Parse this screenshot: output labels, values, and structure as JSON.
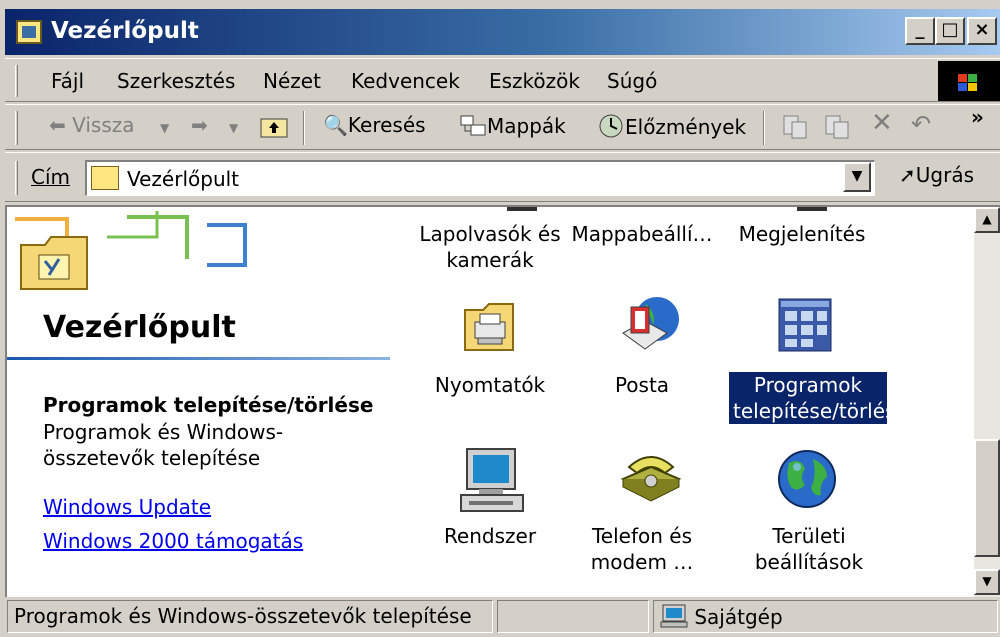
{
  "window": {
    "title": "Vezérlőpult"
  },
  "menu": {
    "items": [
      {
        "label": "Fájl"
      },
      {
        "label": "Szerkesztés"
      },
      {
        "label": "Nézet"
      },
      {
        "label": "Kedvencek"
      },
      {
        "label": "Eszközök"
      },
      {
        "label": "Súgó"
      }
    ]
  },
  "toolbar": {
    "back_label": "Vissza",
    "search_label": "Keresés",
    "folders_label": "Mappák",
    "history_label": "Előzmények",
    "more_glyph": "»"
  },
  "address": {
    "label": "Cím",
    "value": "Vezérlőpult",
    "go_label": "Ugrás"
  },
  "leftpane": {
    "heading": "Vezérlőpult",
    "selected_title": "Programok telepítése/törlése",
    "selected_desc": "Programok és Windows-összetevők telepítése",
    "links": [
      {
        "label": "Windows Update"
      },
      {
        "label": "Windows 2000 támogatás"
      }
    ]
  },
  "items": [
    {
      "label": "Lapolvasók és kamerák",
      "icon": "scanner-camera-icon"
    },
    {
      "label": "Mappabeállí…",
      "icon": "folder-options-icon"
    },
    {
      "label": "Megjelenítés",
      "icon": "display-icon"
    },
    {
      "label": "Nyomtatók",
      "icon": "printer-folder-icon"
    },
    {
      "label": "Posta",
      "icon": "mail-icon"
    },
    {
      "label": "Programok telepítése/törlése",
      "icon": "add-remove-programs-icon",
      "selected": true
    },
    {
      "label": "Rendszer",
      "icon": "computer-icon"
    },
    {
      "label": "Telefon és modem …",
      "icon": "telephone-icon"
    },
    {
      "label": "Területi beállítások",
      "icon": "globe-icon"
    }
  ],
  "status": {
    "text": "Programok és Windows-összetevők telepítése",
    "zone": "Sajátgép"
  },
  "colors": {
    "title_active": "#0a246a",
    "selection": "#0a246a",
    "link": "#0000ee",
    "face": "#d4d0c8"
  }
}
